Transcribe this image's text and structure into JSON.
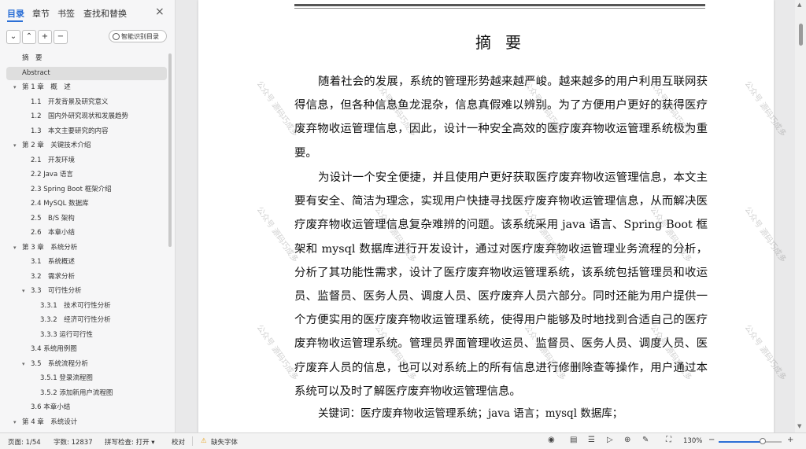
{
  "sidebar": {
    "tabs": [
      "目录",
      "章节",
      "书签",
      "查找和替换"
    ],
    "close_icon": "×",
    "smart_button": "智能识别目录",
    "toc": [
      {
        "label": "摘　要",
        "indent": 0,
        "arrow": ""
      },
      {
        "label": "Abstract",
        "indent": 0,
        "arrow": "",
        "selected": true
      },
      {
        "label": "第 1 章　概　述",
        "indent": 0,
        "arrow": "▾"
      },
      {
        "label": "1.1　开发背景及研究意义",
        "indent": 1,
        "arrow": ""
      },
      {
        "label": "1.2　国内外研究现状和发展趋势",
        "indent": 1,
        "arrow": ""
      },
      {
        "label": "1.3　本文主要研究的内容",
        "indent": 1,
        "arrow": ""
      },
      {
        "label": "第 2 章　关键技术介绍",
        "indent": 0,
        "arrow": "▾"
      },
      {
        "label": "2.1　开发环境",
        "indent": 1,
        "arrow": ""
      },
      {
        "label": "2.2 Java 语言",
        "indent": 1,
        "arrow": ""
      },
      {
        "label": "2.3 Spring Boot 框架介绍",
        "indent": 1,
        "arrow": ""
      },
      {
        "label": "2.4 MySQL 数据库",
        "indent": 1,
        "arrow": ""
      },
      {
        "label": "2.5　B/S 架构",
        "indent": 1,
        "arrow": ""
      },
      {
        "label": "2.6　本章小结",
        "indent": 1,
        "arrow": ""
      },
      {
        "label": "第 3 章　系统分析",
        "indent": 0,
        "arrow": "▾"
      },
      {
        "label": "3.1　系统概述",
        "indent": 1,
        "arrow": ""
      },
      {
        "label": "3.2　需求分析",
        "indent": 1,
        "arrow": ""
      },
      {
        "label": "3.3　可行性分析",
        "indent": 1,
        "arrow": "▾"
      },
      {
        "label": "3.3.1　技术可行性分析",
        "indent": 2,
        "arrow": ""
      },
      {
        "label": "3.3.2　经济可行性分析",
        "indent": 2,
        "arrow": ""
      },
      {
        "label": "3.3.3 运行可行性",
        "indent": 2,
        "arrow": ""
      },
      {
        "label": "3.4 系统用例图",
        "indent": 1,
        "arrow": ""
      },
      {
        "label": "3.5　系统流程分析",
        "indent": 1,
        "arrow": "▾"
      },
      {
        "label": "3.5.1 登录流程图",
        "indent": 2,
        "arrow": ""
      },
      {
        "label": "3.5.2 添加新用户流程图",
        "indent": 2,
        "arrow": ""
      },
      {
        "label": "3.6 本章小结",
        "indent": 1,
        "arrow": ""
      },
      {
        "label": "第 4 章　系统设计",
        "indent": 0,
        "arrow": "▾"
      }
    ]
  },
  "document": {
    "title": "摘要",
    "paragraphs": [
      "随着社会的发展，系统的管理形势越来越严峻。越来越多的用户利用互联网获得信息，但各种信息鱼龙混杂，信息真假难以辨别。为了方便用户更好的获得医疗废弃物收运管理信息，因此，设计一种安全高效的医疗废弃物收运管理系统极为重要。",
      "为设计一个安全便捷，并且使用户更好获取医疗废弃物收运管理信息，本文主要有安全、简洁为理念，实现用户快捷寻找医疗废弃物收运管理信息，从而解决医疗废弃物收运管理信息复杂难辨的问题。该系统采用 java 语言、Spring Boot 框架和 mysql 数据库进行开发设计，通过对医疗废弃物收运管理业务流程的分析，分析了其功能性需求，设计了医疗废弃物收运管理系统，该系统包括管理员和收运员、监督员、医务人员、调度人员、医疗废弃人员六部分。同时还能为用户提供一个方便实用的医疗废弃物收运管理系统，使得用户能够及时地找到合适自己的医疗废弃物收运管理系统。管理员界面管理收运员、监督员、医务人员、调度人员、医疗废弃人员的信息，也可以对系统上的所有信息进行修删除查等操作，用户通过本系统可以及时了解医疗废弃物收运管理信息。"
    ],
    "keywords": "关键词：医疗废弃物收运管理系统；java 语言；mysql 数据库；",
    "watermark": "公众号 源码巧成多"
  },
  "status": {
    "page": "页面: 1/54",
    "words": "字数: 12837",
    "spellcheck": "拼写检查: 打开 ▾",
    "proofread": "校对",
    "missing_font": "缺失字体",
    "zoom": "130%",
    "zoom_level": 0.7
  },
  "colors": {
    "accent": "#2b6fd6",
    "warning": "#e8a320"
  }
}
